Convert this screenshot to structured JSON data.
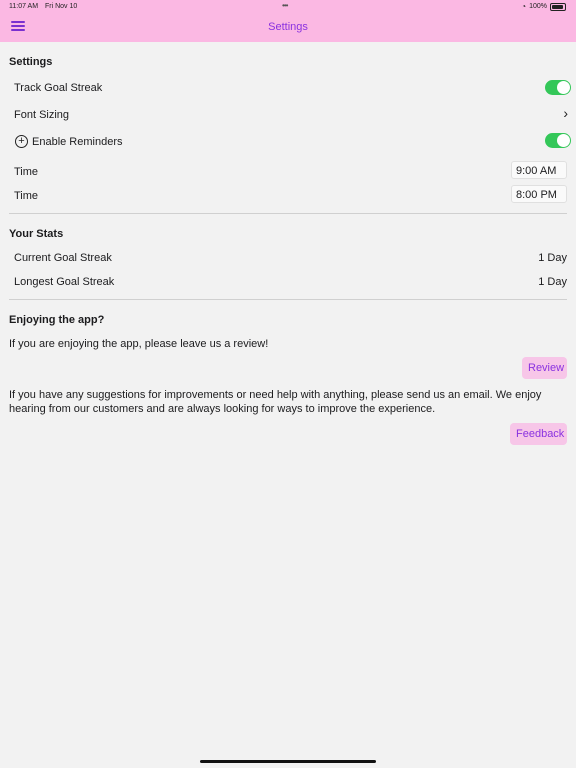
{
  "status_bar": {
    "time": "11:07 AM",
    "date": "Fri Nov 10",
    "battery": "100%"
  },
  "nav": {
    "title": "Settings",
    "accent_color": "#8a32e0",
    "bar_color": "#fbb8e3"
  },
  "settings": {
    "title": "Settings",
    "track_goal_streak": {
      "label": "Track Goal Streak",
      "on": true
    },
    "font_sizing": {
      "label": "Font Sizing"
    },
    "enable_reminders": {
      "label": "Enable Reminders",
      "on": true
    },
    "times": [
      {
        "label": "Time",
        "value": "9:00 AM"
      },
      {
        "label": "Time",
        "value": "8:00 PM"
      }
    ]
  },
  "stats": {
    "title": "Your Stats",
    "rows": [
      {
        "label": "Current Goal Streak",
        "value": "1 Day"
      },
      {
        "label": "Longest Goal Streak",
        "value": "1 Day"
      }
    ]
  },
  "enjoy": {
    "title": "Enjoying the app?",
    "review_text": "If you are enjoying the app, please leave us a review!",
    "review_button": "Review",
    "feedback_text": "If you have any suggestions for improvements or need help with anything, please send us an email. We enjoy hearing from our customers and are always looking for ways to improve the experience.",
    "feedback_button": "Feedback"
  },
  "toggle_color": "#34c759",
  "button_bg": "#f7c6e8"
}
